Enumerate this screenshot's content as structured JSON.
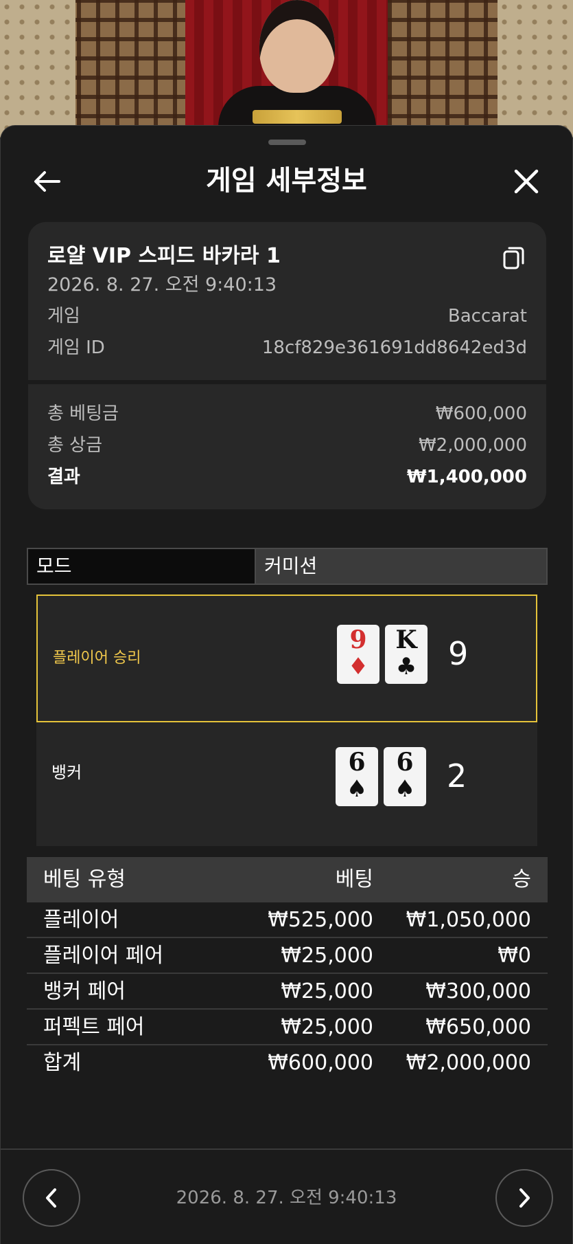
{
  "header": {
    "title": "게임 세부정보"
  },
  "info": {
    "game_name": "로얄 VIP 스피드 바카라 1",
    "timestamp": "2026. 8. 27. 오전 9:40:13",
    "rows": [
      {
        "key": "게임",
        "value": "Baccarat"
      },
      {
        "key": "게임 ID",
        "value": "18cf829e361691dd8642ed3d"
      }
    ],
    "totals": [
      {
        "key": "총 베팅금",
        "value": "₩600,000"
      },
      {
        "key": "총 상금",
        "value": "₩2,000,000"
      },
      {
        "key": "결과",
        "value": "₩1,400,000"
      }
    ]
  },
  "tabs": [
    {
      "label": "모드"
    },
    {
      "label": "커미션"
    }
  ],
  "results": {
    "player": {
      "label": "플레이어 승리",
      "cards": [
        {
          "rank": "9",
          "suit": "♦",
          "color": "#d32f2f"
        },
        {
          "rank": "K",
          "suit": "♣",
          "color": "#111111"
        }
      ],
      "score": "9"
    },
    "banker": {
      "label": "뱅커",
      "cards": [
        {
          "rank": "6",
          "suit": "♠",
          "color": "#111111"
        },
        {
          "rank": "6",
          "suit": "♠",
          "color": "#111111"
        }
      ],
      "score": "2"
    }
  },
  "bets": {
    "headers": [
      "베팅 유형",
      "베팅",
      "승"
    ],
    "rows": [
      [
        "플레이어",
        "₩525,000",
        "₩1,050,000"
      ],
      [
        "플레이어 페어",
        "₩25,000",
        "₩0"
      ],
      [
        "뱅커 페어",
        "₩25,000",
        "₩300,000"
      ],
      [
        "퍼펙트 페어",
        "₩25,000",
        "₩650,000"
      ],
      [
        "합계",
        "₩600,000",
        "₩2,000,000"
      ]
    ]
  },
  "footer": {
    "timestamp": "2026. 8. 27. 오전 9:40:13"
  },
  "colors": {
    "accent": "#e5c33a",
    "background": "#1b1b1b"
  },
  "icons": [
    "back-arrow-icon",
    "close-icon",
    "copy-icon",
    "chevron-left-icon",
    "chevron-right-icon"
  ]
}
